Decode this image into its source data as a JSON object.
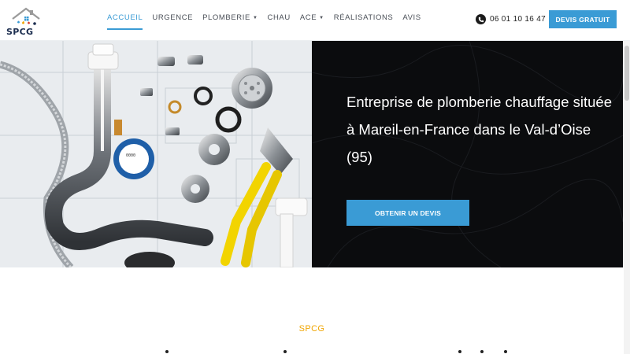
{
  "brand": {
    "name": "SPCG",
    "accent": "#3a9bd5",
    "gold": "#f0a500",
    "dark": "#0b0c0e"
  },
  "nav": {
    "items": [
      {
        "label": "Accueil",
        "active": true,
        "dropdown": false
      },
      {
        "label": "Urgence",
        "active": false,
        "dropdown": false
      },
      {
        "label": "Plomberie",
        "active": false,
        "dropdown": true
      },
      {
        "label": "Chau",
        "active": false,
        "dropdown": false
      },
      {
        "label": "ACE",
        "active": false,
        "dropdown": true
      },
      {
        "label": "Réalisations",
        "active": false,
        "dropdown": false
      },
      {
        "label": "Avis",
        "active": false,
        "dropdown": false
      }
    ]
  },
  "header": {
    "phone_icon": "phone-icon",
    "phone_number": "06 01 10 16 47",
    "cta_label": "Devis gratuit"
  },
  "hero": {
    "title": "Entreprise de plomberie chauffage située à Mareil-en-France dans le Val-d’Oise (95)",
    "cta_label": "Obtenir un devis"
  },
  "section": {
    "label": "SPCG"
  }
}
